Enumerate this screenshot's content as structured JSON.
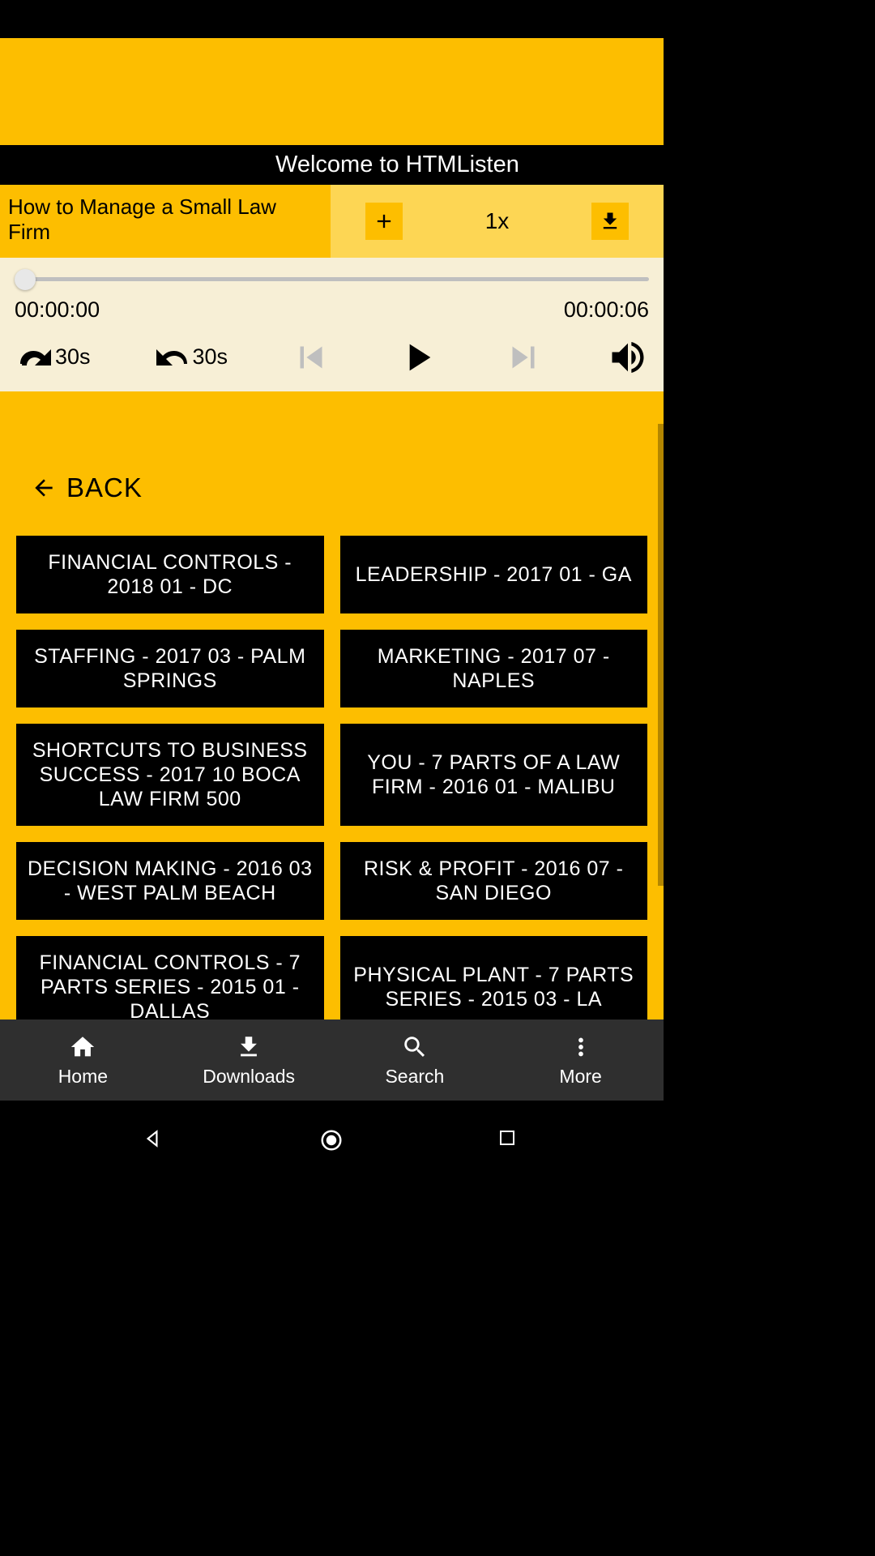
{
  "welcome": "Welcome to HTMListen",
  "player": {
    "title": "How to Manage a Small Law Firm",
    "speed": "1x",
    "current_time": "00:00:00",
    "total_time": "00:00:06",
    "skip_fwd": "30s",
    "skip_back": "30s"
  },
  "back_label": "BACK",
  "tiles": [
    "FINANCIAL CONTROLS - 2018 01 - DC",
    "LEADERSHIP - 2017 01 - GA",
    "STAFFING - 2017 03 - PALM SPRINGS",
    "MARKETING - 2017 07 - NAPLES",
    "SHORTCUTS TO BUSINESS SUCCESS - 2017 10 BOCA LAW FIRM 500",
    "YOU - 7 PARTS OF A LAW FIRM - 2016 01 - MALIBU",
    "DECISION MAKING - 2016 03 - WEST PALM BEACH",
    "RISK & PROFIT - 2016 07 - SAN DIEGO",
    "FINANCIAL CONTROLS - 7 PARTS SERIES - 2015 01 - DALLAS",
    "PHYSICAL PLANT - 7 PARTS SERIES - 2015 03 - LA"
  ],
  "nav": {
    "home": "Home",
    "downloads": "Downloads",
    "search": "Search",
    "more": "More"
  }
}
